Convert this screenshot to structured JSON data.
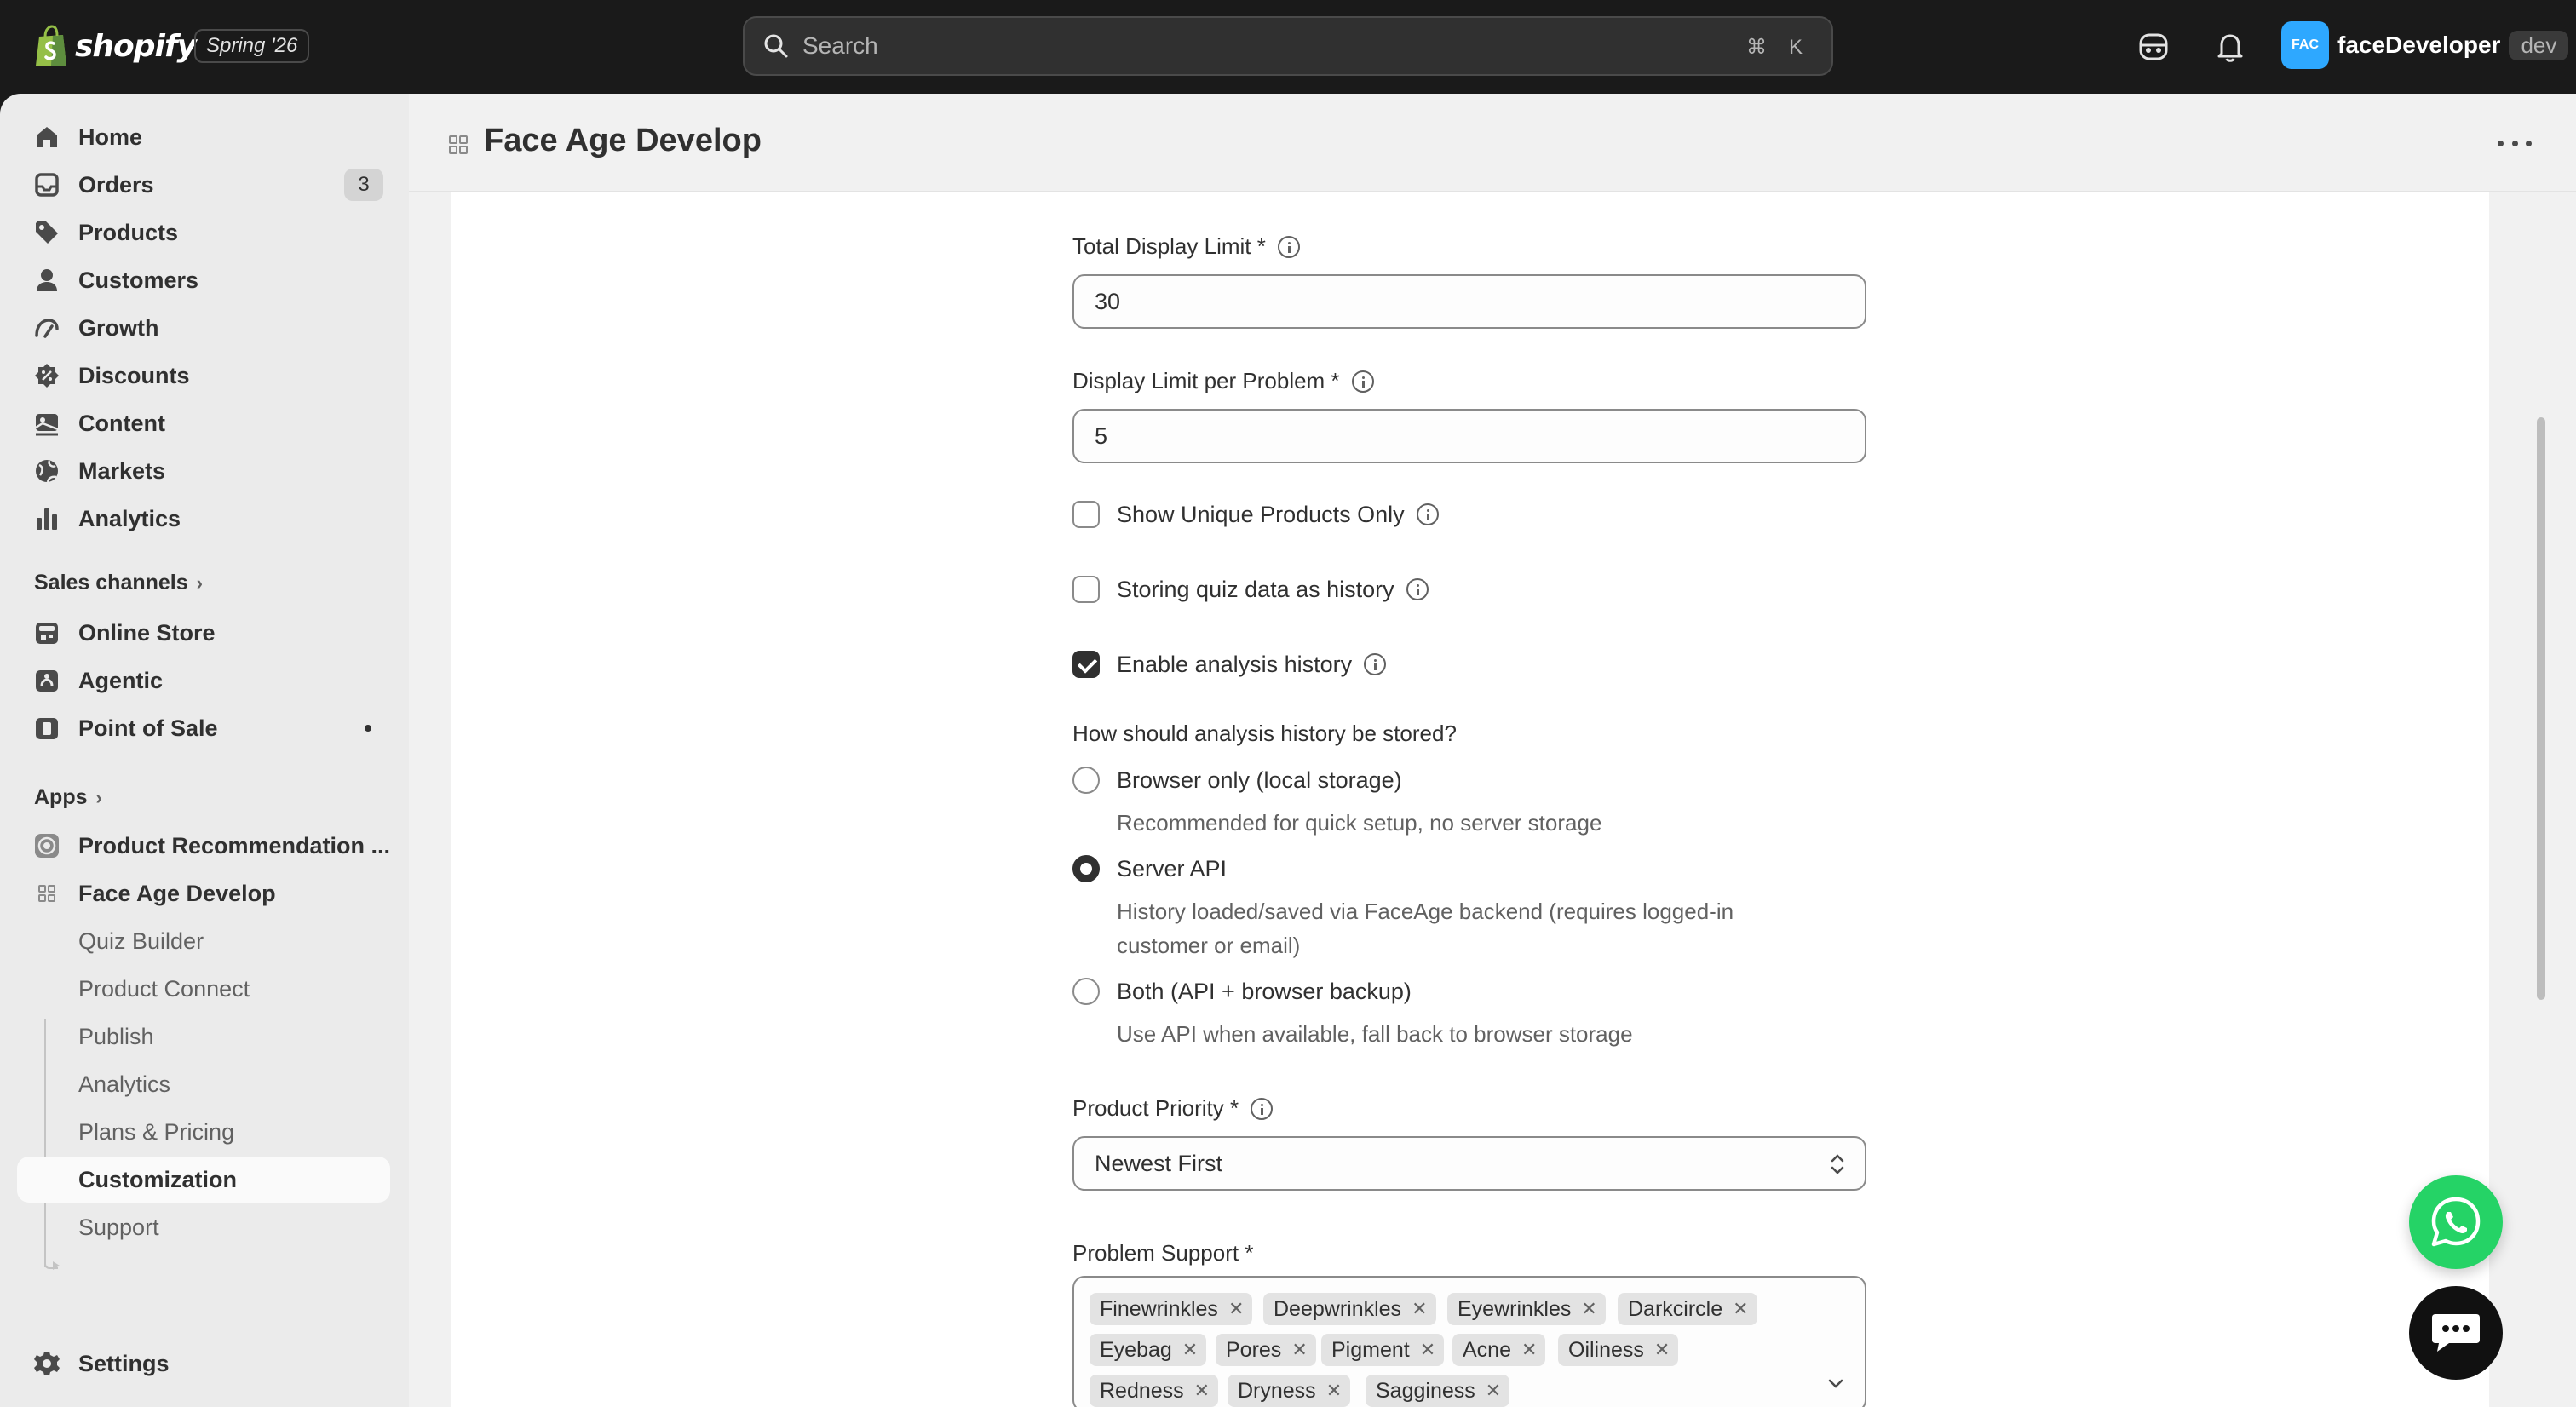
{
  "topbar": {
    "logo_text": "shopify",
    "edition": "Spring '26",
    "search_placeholder": "Search",
    "shortcut_mod": "⌘",
    "shortcut_key": "K",
    "store_initials": "FAC",
    "store_name": "faceDeveloper",
    "store_badge": "dev"
  },
  "sidebar": {
    "main_items": [
      {
        "label": "Home",
        "icon": "home-icon"
      },
      {
        "label": "Orders",
        "icon": "orders-icon",
        "count": "3"
      },
      {
        "label": "Products",
        "icon": "tag-icon"
      },
      {
        "label": "Customers",
        "icon": "person-icon"
      },
      {
        "label": "Growth",
        "icon": "gauge-icon"
      },
      {
        "label": "Discounts",
        "icon": "discount-icon"
      },
      {
        "label": "Content",
        "icon": "content-icon"
      },
      {
        "label": "Markets",
        "icon": "globe-icon"
      },
      {
        "label": "Analytics",
        "icon": "bar-chart-icon"
      }
    ],
    "sales_channels_label": "Sales channels",
    "channels": [
      {
        "label": "Online Store",
        "icon": "store-icon"
      },
      {
        "label": "Agentic",
        "icon": "agentic-icon"
      },
      {
        "label": "Point of Sale",
        "icon": "pos-icon"
      }
    ],
    "apps_label": "Apps",
    "apps": [
      {
        "label": "Product Recommendation ...",
        "icon": "app-icon"
      },
      {
        "label": "Face Age Develop",
        "icon": "grid-app-icon"
      }
    ],
    "app_subitems": [
      "Quiz Builder",
      "Product Connect",
      "Publish",
      "Analytics",
      "Plans & Pricing",
      "Customization",
      "Support"
    ],
    "settings_label": "Settings"
  },
  "page": {
    "title": "Face Age Develop"
  },
  "form": {
    "total_limit_label": "Total Display Limit *",
    "total_limit_value": "30",
    "per_problem_label": "Display Limit per Problem *",
    "per_problem_value": "5",
    "unique_products_label": "Show Unique Products Only",
    "quiz_history_label": "Storing quiz data as history",
    "analysis_history_label": "Enable analysis history",
    "storage_question": "How should analysis history be stored?",
    "storage_options": [
      {
        "label": "Browser only (local storage)",
        "helper": "Recommended for quick setup, no server storage"
      },
      {
        "label": "Server API",
        "helper": "History loaded/saved via FaceAge backend (requires logged-in customer or email)"
      },
      {
        "label": "Both (API + browser backup)",
        "helper": "Use API when available, fall back to browser storage"
      }
    ],
    "priority_label": "Product Priority *",
    "priority_value": "Newest First",
    "problem_support_label": "Problem Support *",
    "problem_tags": [
      "Finewrinkles",
      "Deepwrinkles",
      "Eyewrinkles",
      "Darkcircle",
      "Eyebag",
      "Pores",
      "Pigment",
      "Acne",
      "Oiliness",
      "Redness",
      "Dryness",
      "Sagginess"
    ]
  },
  "colors": {
    "topbar_bg": "#1a1a1a",
    "sidebar_bg": "#ebebeb",
    "store_avatar": "#2ea8ff",
    "whatsapp": "#25d366"
  }
}
